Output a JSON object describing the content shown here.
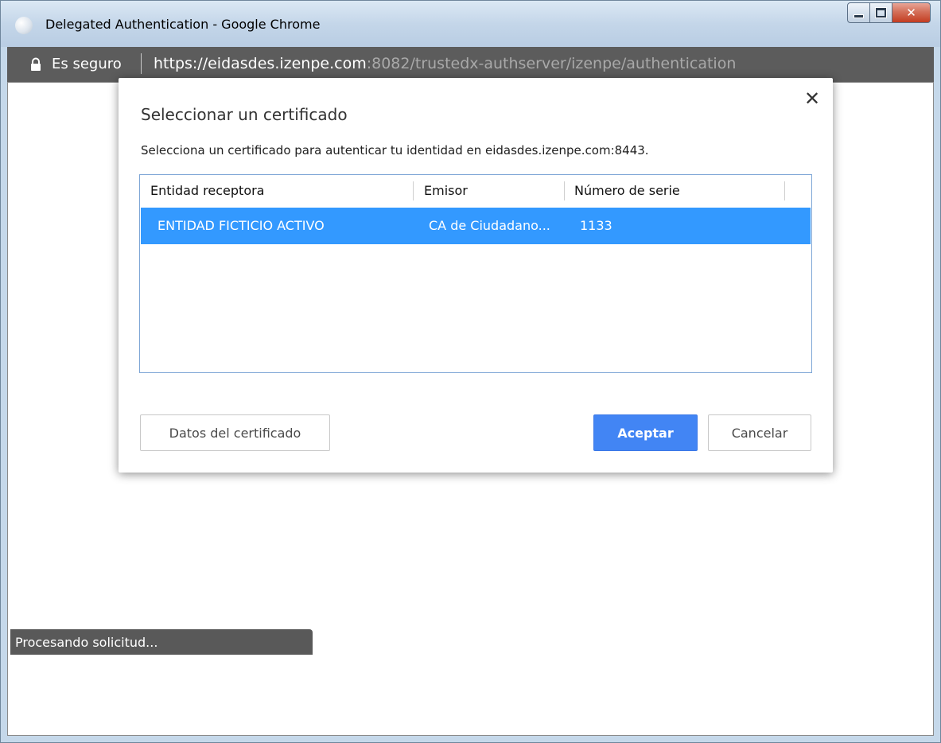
{
  "window": {
    "title": "Delegated Authentication - Google Chrome"
  },
  "addressbar": {
    "security_label": "Es seguro",
    "url_host": "https://eidasdes.izenpe.com",
    "url_rest": ":8082/trustedx-authserver/izenpe/authentication"
  },
  "dialog": {
    "title": "Seleccionar un certificado",
    "description": "Selecciona un certificado para autenticar tu identidad en eidasdes.izenpe.com:8443.",
    "columns": [
      "Entidad receptora",
      "Emisor",
      "Número de serie"
    ],
    "rows": [
      {
        "subject": "ENTIDAD FICTICIO ACTIVO",
        "issuer": "CA de Ciudadano...",
        "serial": "1133",
        "selected": true
      }
    ],
    "buttons": {
      "details": "Datos del certificado",
      "accept": "Aceptar",
      "cancel": "Cancelar"
    }
  },
  "status": {
    "text": "Procesando solicitud..."
  },
  "colors": {
    "selection": "#3399ff",
    "primary_button": "#4285f4",
    "addressbar": "#5c5c5c"
  }
}
